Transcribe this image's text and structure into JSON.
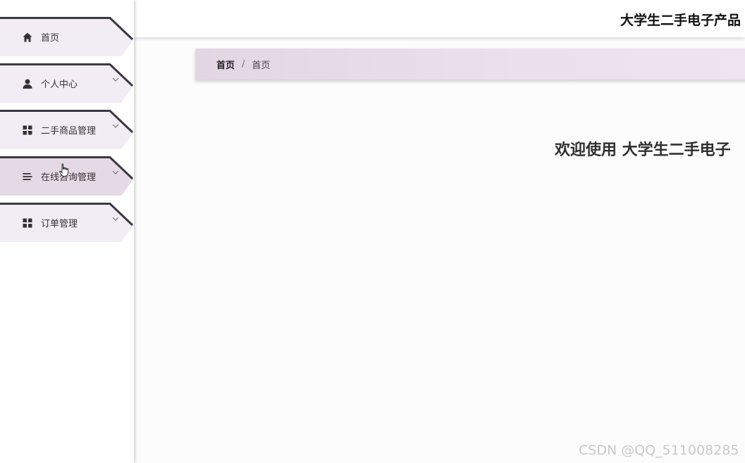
{
  "app": {
    "title": "大学生二手电子产品",
    "welcome": "欢迎使用 大学生二手电子"
  },
  "sidebar": {
    "items": [
      {
        "label": "首页",
        "icon": "home-icon",
        "has_children": false
      },
      {
        "label": "个人中心",
        "icon": "user-icon",
        "has_children": true
      },
      {
        "label": "二手商品管理",
        "icon": "grid-icon",
        "has_children": true
      },
      {
        "label": "在线咨询管理",
        "icon": "list-icon",
        "has_children": true,
        "hovered": true
      },
      {
        "label": "订单管理",
        "icon": "grid-icon",
        "has_children": true
      }
    ]
  },
  "breadcrumb": {
    "items": [
      "首页",
      "首页"
    ],
    "separator": "/"
  },
  "watermark": "CSDN @QQ_511008285",
  "colors": {
    "menu_bg": "#f2ecf5",
    "menu_bg_hover": "#e6d9e6",
    "menu_border": "#3a3a42",
    "breadcrumb_bg": "#e8dbe8",
    "text": "#333333"
  }
}
